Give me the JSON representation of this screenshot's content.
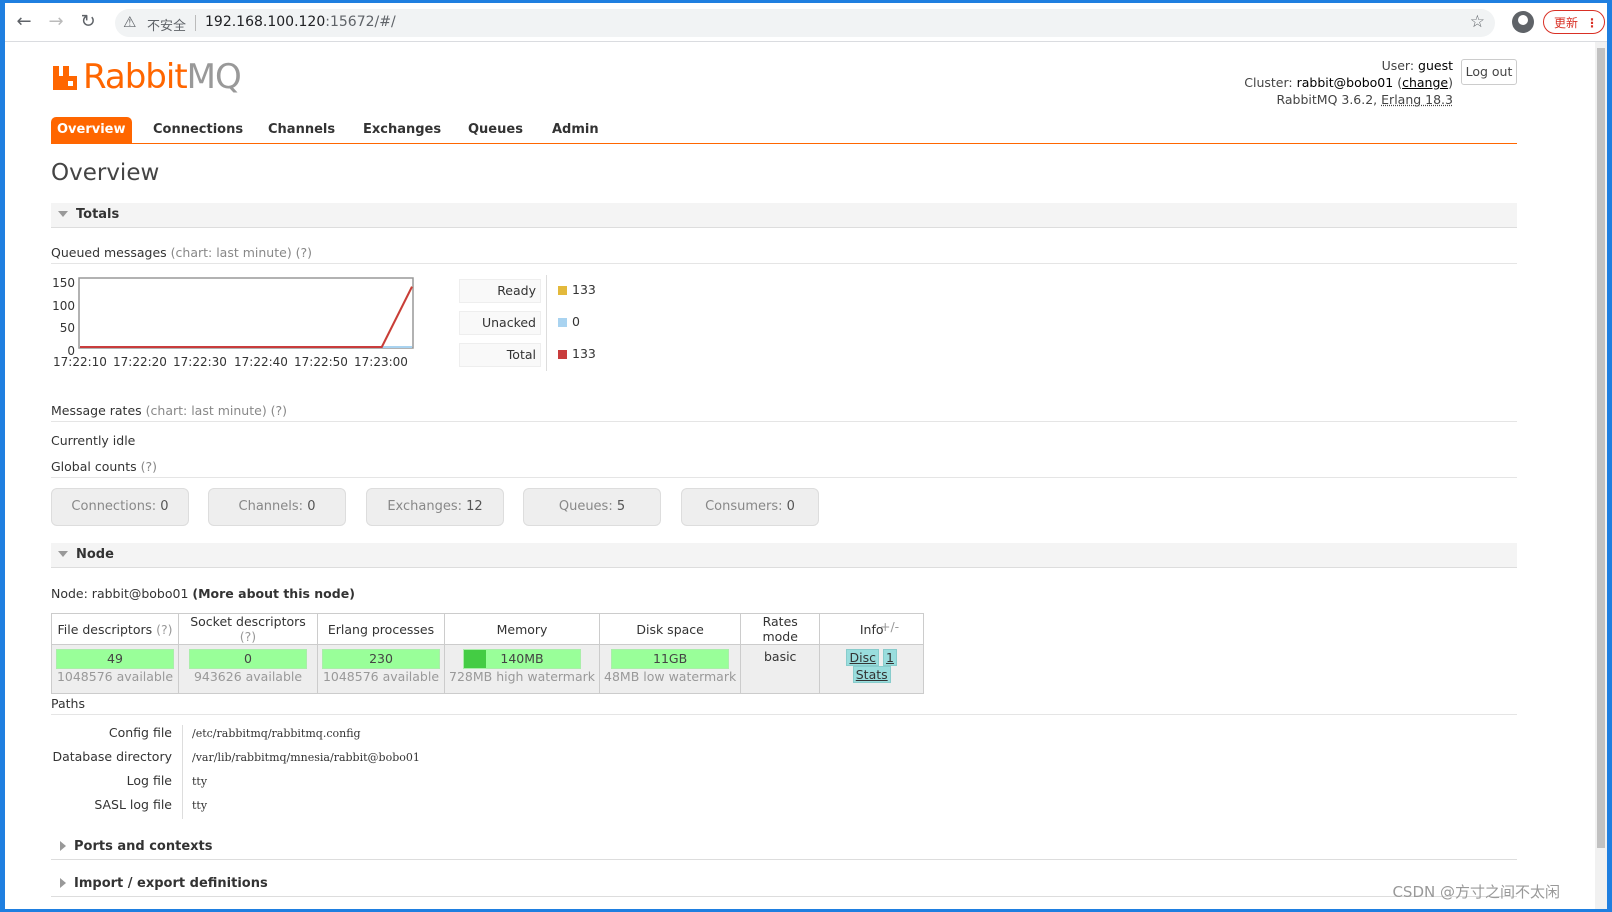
{
  "browser": {
    "security_label": "不安全",
    "url_host": "192.168.100.120",
    "url_rest": ":15672/#/",
    "update_label": "更新"
  },
  "header": {
    "logo_brand": "Rabbit",
    "logo_suffix": "MQ",
    "user_label": "User:",
    "user_value": "guest",
    "cluster_label": "Cluster:",
    "cluster_value": "rabbit@bobo01",
    "cluster_change_open": "(",
    "cluster_change": "change",
    "cluster_change_close": ")",
    "version": "RabbitMQ 3.6.2,",
    "erlang": "Erlang 18.3",
    "logout": "Log out"
  },
  "tabs": [
    "Overview",
    "Connections",
    "Channels",
    "Exchanges",
    "Queues",
    "Admin"
  ],
  "page_title": "Overview",
  "totals": {
    "section_title": "Totals",
    "queued_title": "Queued messages",
    "queued_note": "(chart: last minute) (?)",
    "chart_data": {
      "type": "line",
      "x": [
        "17:22:10",
        "17:22:20",
        "17:22:30",
        "17:22:40",
        "17:22:50",
        "17:23:00",
        "17:23:05"
      ],
      "series": [
        {
          "name": "Ready",
          "values": [
            0,
            0,
            0,
            0,
            0,
            0,
            133
          ]
        },
        {
          "name": "Unacked",
          "values": [
            0,
            0,
            0,
            0,
            0,
            0,
            0
          ]
        },
        {
          "name": "Total",
          "values": [
            0,
            0,
            0,
            0,
            0,
            0,
            133
          ]
        }
      ],
      "y_ticks": [
        "150",
        "100",
        "50",
        "0"
      ],
      "x_ticks": [
        "17:22:10",
        "17:22:20",
        "17:22:30",
        "17:22:40",
        "17:22:50",
        "17:23:00"
      ],
      "ylim": [
        0,
        150
      ]
    },
    "legend": [
      {
        "label": "Ready",
        "value": "133",
        "color": "#e3b93b"
      },
      {
        "label": "Unacked",
        "value": "0",
        "color": "#a9d3f0"
      },
      {
        "label": "Total",
        "value": "133",
        "color": "#c93c3c"
      }
    ],
    "rates_title": "Message rates",
    "rates_note": "(chart: last minute) (?)",
    "idle": "Currently idle",
    "global_title": "Global counts",
    "global_note": "(?)",
    "counts": [
      {
        "label": "Connections:",
        "value": "0"
      },
      {
        "label": "Channels:",
        "value": "0"
      },
      {
        "label": "Exchanges:",
        "value": "12"
      },
      {
        "label": "Queues:",
        "value": "5"
      },
      {
        "label": "Consumers:",
        "value": "0"
      }
    ]
  },
  "node": {
    "section_title": "Node",
    "node_label": "Node: rabbit@bobo01",
    "more": "(More about this node)",
    "columns": [
      "File descriptors",
      "Socket descriptors",
      "Erlang processes",
      "Memory",
      "Disk space",
      "Rates mode",
      "Info"
    ],
    "col_help": "(?)",
    "file_desc": {
      "value": "49",
      "avail": "1048576 available",
      "fraction": 5e-05
    },
    "socket_desc": {
      "value": "0",
      "avail": "943626 available",
      "fraction": 0
    },
    "erlang_proc": {
      "value": "230",
      "avail": "1048576 available",
      "fraction": 0.0002
    },
    "memory": {
      "value": "140MB",
      "avail": "728MB high watermark",
      "fraction": 0.19
    },
    "disk": {
      "value": "11GB",
      "avail": "48MB low watermark",
      "fraction": 0
    },
    "rates_mode": "basic",
    "info_tags": [
      "Disc",
      "1",
      "Stats"
    ],
    "plus_minus": "+/-"
  },
  "paths": {
    "title": "Paths",
    "rows": [
      {
        "key": "Config file",
        "value": "/etc/rabbitmq/rabbitmq.config"
      },
      {
        "key": "Database directory",
        "value": "/var/lib/rabbitmq/mnesia/rabbit@bobo01"
      },
      {
        "key": "Log file",
        "value": "tty"
      },
      {
        "key": "SASL log file",
        "value": "tty"
      }
    ]
  },
  "collapsed_sections": [
    "Ports and contexts",
    "Import / export definitions"
  ],
  "watermark": "CSDN @方寸之间不太闲"
}
